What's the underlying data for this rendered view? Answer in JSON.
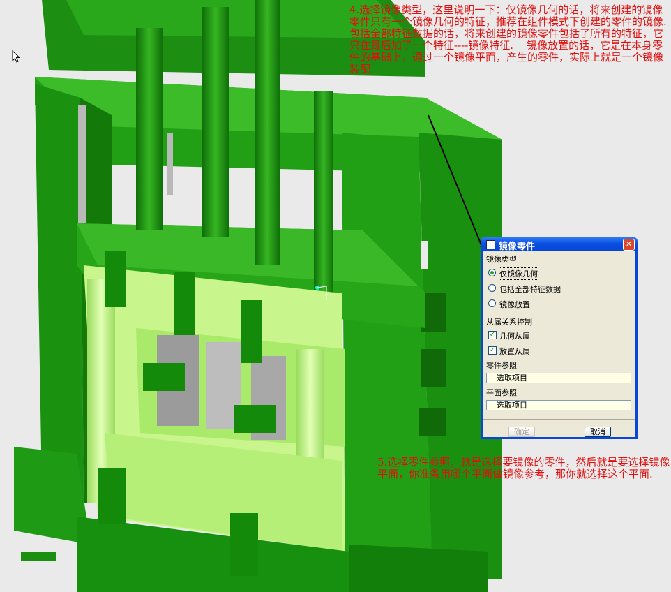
{
  "annotations": {
    "top": "4.选择镜像类型，这里说明一下：仅镜像几何的话，将来创建的镜像零件只有一个镜像几何的特征，推荐在组件模式下创建的零件的镜像.    包括全部特征数据的话，将来创建的镜像零件包括了所有的特征，它只在最后加了一个特征----镜像特征.    镜像放置的话，它是在本身零件的基础上，通过一个镜像平面，产生的零件，实际上就是一个镜像装配.",
    "bottom": "5.选择零件参照，就是选择要镜像的零件，然后就是要选择镜像平面，你准备用哪个平面做镜像参考，那你就选择这个平面."
  },
  "dialog": {
    "title": "镜像零件",
    "mirror_type_label": "镜像类型",
    "options": [
      {
        "label": "仅镜像几何",
        "selected": true
      },
      {
        "label": "包括全部特征数据",
        "selected": false
      },
      {
        "label": "镜像放置",
        "selected": false
      }
    ],
    "dependency_label": "从属关系控制",
    "checks": [
      {
        "label": "几何从属",
        "checked": true
      },
      {
        "label": "放置从属",
        "checked": true
      }
    ],
    "part_ref_label": "零件参照",
    "part_ref_value": "选取项目",
    "plane_ref_label": "平面参照",
    "plane_ref_value": "选取项目",
    "ok_label": "确定",
    "cancel_label": "取消"
  },
  "colors": {
    "frame_green": "#1f9a14",
    "frame_dark": "#137a0a",
    "inner_light": "#b8f07a",
    "annotation_red": "#e01010",
    "dialog_blue": "#0a46d8"
  }
}
